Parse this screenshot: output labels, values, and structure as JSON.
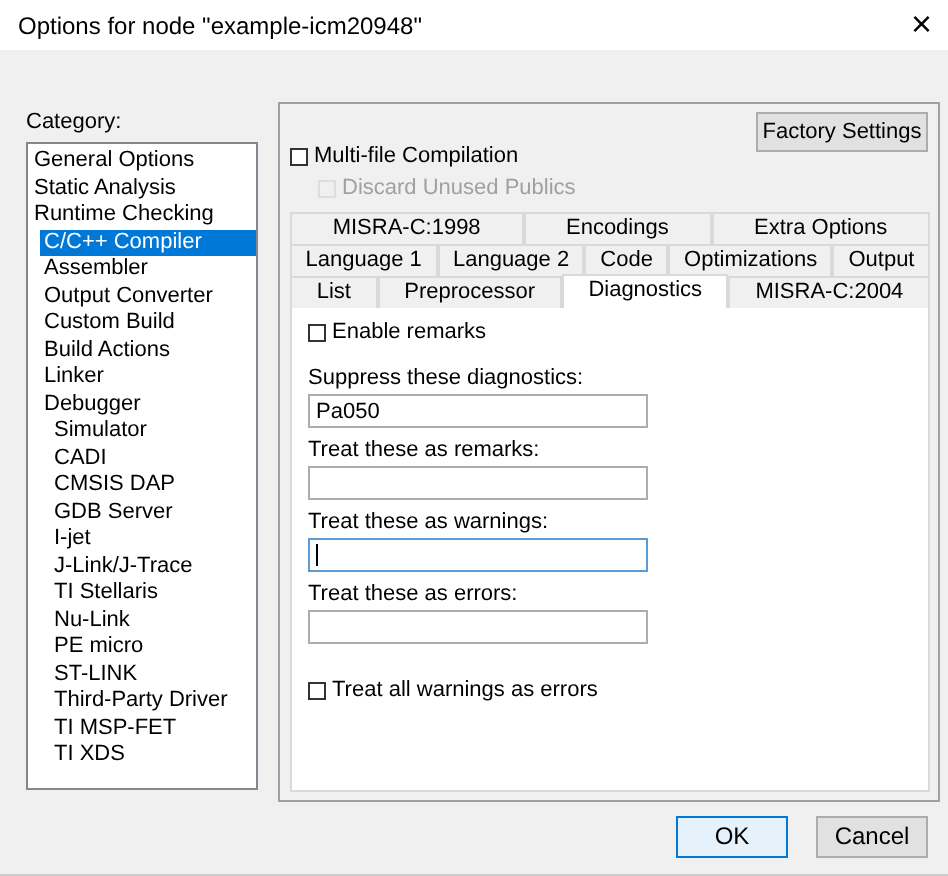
{
  "window": {
    "title": "Options for node \"example-icm20948\"",
    "close": "×"
  },
  "category": {
    "label": "Category:",
    "items": [
      {
        "label": "General Options",
        "selected": false
      },
      {
        "label": "Static Analysis",
        "selected": false
      },
      {
        "label": "Runtime Checking",
        "selected": false
      },
      {
        "label": "C/C++ Compiler",
        "selected": true
      },
      {
        "label": "Assembler",
        "selected": false
      },
      {
        "label": "Output Converter",
        "selected": false
      },
      {
        "label": "Custom Build",
        "selected": false
      },
      {
        "label": "Build Actions",
        "selected": false
      },
      {
        "label": "Linker",
        "selected": false
      },
      {
        "label": "Debugger",
        "selected": false,
        "children": [
          {
            "label": "Simulator",
            "selected": false
          },
          {
            "label": "CADI",
            "selected": false
          },
          {
            "label": "CMSIS DAP",
            "selected": false
          },
          {
            "label": "GDB Server",
            "selected": false
          },
          {
            "label": "I-jet",
            "selected": false
          },
          {
            "label": "J-Link/J-Trace",
            "selected": false
          },
          {
            "label": "TI Stellaris",
            "selected": false
          },
          {
            "label": "Nu-Link",
            "selected": false
          },
          {
            "label": "PE micro",
            "selected": false
          },
          {
            "label": "ST-LINK",
            "selected": false
          },
          {
            "label": "Third-Party Driver",
            "selected": false
          },
          {
            "label": "TI MSP-FET",
            "selected": false
          },
          {
            "label": "TI XDS",
            "selected": false
          }
        ]
      }
    ]
  },
  "factory_button": "Factory Settings",
  "options": [
    {
      "label": "Multi-file Compilation",
      "checked": false,
      "disabled": false,
      "children": [
        {
          "label": "Discard Unused Publics",
          "checked": false,
          "disabled": true
        }
      ]
    }
  ],
  "tab_rows": [
    [
      {
        "label": "MISRA-C:1998",
        "selected": false
      },
      {
        "label": "Encodings",
        "selected": false
      },
      {
        "label": "Extra Options",
        "selected": false
      }
    ],
    [
      {
        "label": "Language 1",
        "selected": false
      },
      {
        "label": "Language 2",
        "selected": false
      },
      {
        "label": "Code",
        "selected": false
      },
      {
        "label": "Optimizations",
        "selected": false
      },
      {
        "label": "Output",
        "selected": false
      }
    ],
    [
      {
        "label": "List",
        "selected": false
      },
      {
        "label": "Preprocessor",
        "selected": false
      },
      {
        "label": "Diagnostics",
        "selected": true
      },
      {
        "label": "MISRA-C:2004",
        "selected": false
      }
    ]
  ],
  "diagnostics": {
    "enable_remarks": {
      "label": "Enable remarks",
      "checked": false
    },
    "fields": [
      {
        "label": "Suppress these diagnostics:",
        "value": "Pa050",
        "focused": false
      },
      {
        "label": "Treat these as remarks:",
        "focused": false
      },
      {
        "label": "Treat these as warnings:",
        "focused": true
      },
      {
        "label": "Treat these as errors:",
        "focused": false
      }
    ],
    "warnings_as_errors": {
      "label": "Treat all warnings as errors",
      "checked": false
    }
  },
  "buttons": [
    {
      "label": "OK",
      "default": true
    },
    {
      "label": "Cancel",
      "default": false
    }
  ]
}
